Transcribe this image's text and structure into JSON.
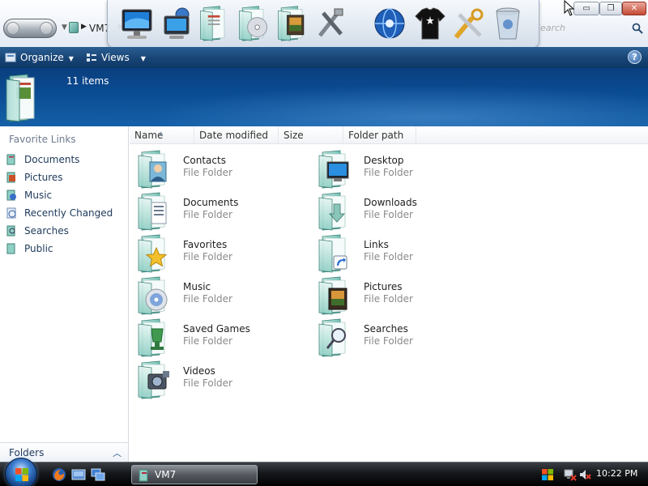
{
  "window": {
    "address": {
      "location": "VM7",
      "search_placeholder": "Search"
    },
    "controls": {
      "minimize": "▭",
      "maximize": "❐",
      "close": "✕"
    }
  },
  "dock": {
    "icons": [
      "computer-icon",
      "network-monitor-icon",
      "documents-icon",
      "music-cd-icon",
      "pictures-icon",
      "tools-icon",
      "internet-globe-icon",
      "tshirt-icon",
      "settings-tools-icon",
      "recycle-bin-icon"
    ]
  },
  "toolbar": {
    "organize_label": "Organize",
    "views_label": "Views",
    "help": "?"
  },
  "details": {
    "items_count": "11 items"
  },
  "navpane": {
    "title": "Favorite Links",
    "items": [
      {
        "label": "Documents",
        "icon": "documents-icon"
      },
      {
        "label": "Pictures",
        "icon": "pictures-icon"
      },
      {
        "label": "Music",
        "icon": "music-icon"
      },
      {
        "label": "Recently Changed",
        "icon": "recently-changed-icon"
      },
      {
        "label": "Searches",
        "icon": "searches-icon"
      },
      {
        "label": "Public",
        "icon": "public-icon"
      }
    ],
    "folders_label": "Folders"
  },
  "columns": {
    "name": "Name",
    "date_modified": "Date modified",
    "size": "Size",
    "folder_path": "Folder path"
  },
  "folders": [
    {
      "name": "Contacts",
      "type": "File Folder",
      "icon": "contacts-folder-icon"
    },
    {
      "name": "Desktop",
      "type": "File Folder",
      "icon": "desktop-folder-icon"
    },
    {
      "name": "Documents",
      "type": "File Folder",
      "icon": "documents-folder-icon"
    },
    {
      "name": "Downloads",
      "type": "File Folder",
      "icon": "downloads-folder-icon"
    },
    {
      "name": "Favorites",
      "type": "File Folder",
      "icon": "favorites-folder-icon"
    },
    {
      "name": "Links",
      "type": "File Folder",
      "icon": "links-folder-icon"
    },
    {
      "name": "Music",
      "type": "File Folder",
      "icon": "music-folder-icon"
    },
    {
      "name": "Pictures",
      "type": "File Folder",
      "icon": "pictures-folder-icon"
    },
    {
      "name": "Saved Games",
      "type": "File Folder",
      "icon": "saved-games-folder-icon"
    },
    {
      "name": "Searches",
      "type": "File Folder",
      "icon": "searches-folder-icon"
    },
    {
      "name": "Videos",
      "type": "File Folder",
      "icon": "videos-folder-icon"
    }
  ],
  "taskbar": {
    "task_label": "VM7",
    "clock": "10:22 PM"
  },
  "colors": {
    "toolbar_blue": "#1a4677",
    "details_blue": "#0a4b92",
    "folder_teal": "#5fb3a6",
    "link_blue": "#1e395b",
    "muted_gray": "#8a8a8a"
  }
}
